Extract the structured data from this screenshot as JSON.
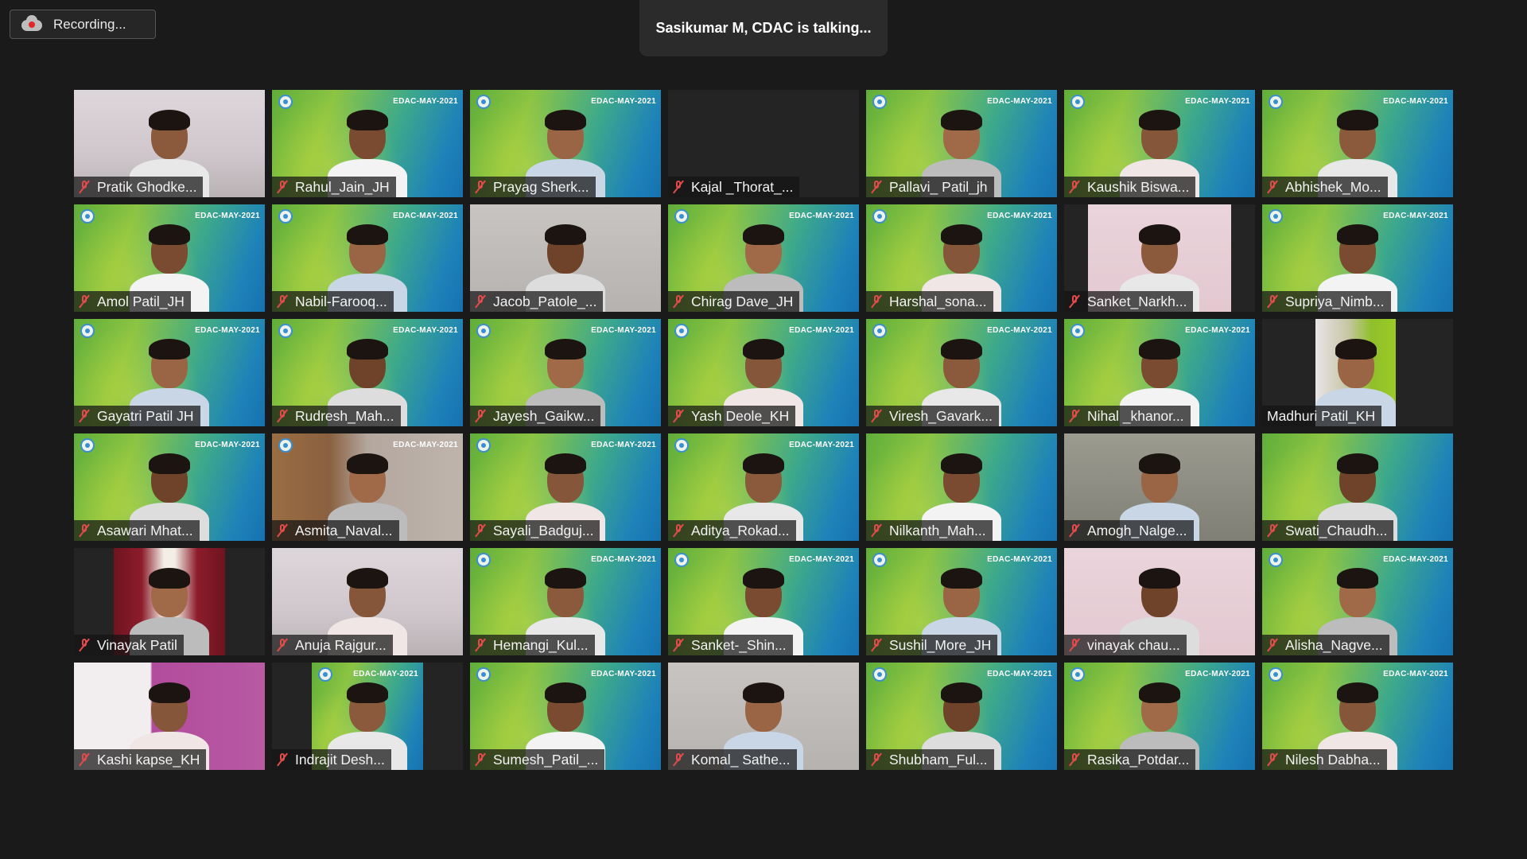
{
  "recording": {
    "label": "Recording..."
  },
  "speaker": {
    "text": "Sasikumar M, CDAC is talking..."
  },
  "batch_text": "EDAC-MAY-2021",
  "colors": {
    "mic_muted": "#e34b4b",
    "background": "#1a1a1a"
  },
  "participants": [
    {
      "name": "Pratik Ghodke...",
      "muted": true
    },
    {
      "name": "Rahul_Jain_JH",
      "muted": true
    },
    {
      "name": "Prayag Sherk...",
      "muted": true
    },
    {
      "name": "Kajal _Thorat_...",
      "muted": true
    },
    {
      "name": "Pallavi_ Patil_jh",
      "muted": true
    },
    {
      "name": "Kaushik Biswa...",
      "muted": true
    },
    {
      "name": "Abhishek_Mo...",
      "muted": true
    },
    {
      "name": "Amol Patil_JH",
      "muted": true
    },
    {
      "name": "Nabil-Farooq...",
      "muted": true
    },
    {
      "name": "Jacob_Patole_...",
      "muted": true
    },
    {
      "name": "Chirag Dave_JH",
      "muted": true
    },
    {
      "name": "Harshal_sona...",
      "muted": true
    },
    {
      "name": "Sanket_Narkh...",
      "muted": true
    },
    {
      "name": "Supriya_Nimb...",
      "muted": true
    },
    {
      "name": "Gayatri Patil JH",
      "muted": true
    },
    {
      "name": "Rudresh_Mah...",
      "muted": true
    },
    {
      "name": "Jayesh_Gaikw...",
      "muted": true
    },
    {
      "name": "Yash Deole_KH",
      "muted": true
    },
    {
      "name": "Viresh_Gavark...",
      "muted": true
    },
    {
      "name": "Nihal _khanor...",
      "muted": true
    },
    {
      "name": "Madhuri Patil_KH",
      "muted": false
    },
    {
      "name": "Asawari Mhat...",
      "muted": true
    },
    {
      "name": "Asmita_Naval...",
      "muted": true
    },
    {
      "name": "Sayali_Badguj...",
      "muted": true
    },
    {
      "name": "Aditya_Rokad...",
      "muted": true
    },
    {
      "name": "Nilkanth_Mah...",
      "muted": true
    },
    {
      "name": "Amogh_Nalge...",
      "muted": true
    },
    {
      "name": "Swati_Chaudh...",
      "muted": true
    },
    {
      "name": "Vinayak Patil",
      "muted": true
    },
    {
      "name": "Anuja Rajgur...",
      "muted": true
    },
    {
      "name": "Hemangi_Kul...",
      "muted": true
    },
    {
      "name": "Sanket-_Shin...",
      "muted": true
    },
    {
      "name": "Sushil_More_JH",
      "muted": true
    },
    {
      "name": "vinayak chau...",
      "muted": true
    },
    {
      "name": "Alisha_Nagve...",
      "muted": true
    },
    {
      "name": "Kashi kapse_KH",
      "muted": true
    },
    {
      "name": "Indrajit Desh...",
      "muted": true
    },
    {
      "name": "Sumesh_Patil_...",
      "muted": true
    },
    {
      "name": "Komal_ Sathe...",
      "muted": true
    },
    {
      "name": "Shubham_Ful...",
      "muted": true
    },
    {
      "name": "Rasika_Potdar...",
      "muted": true
    },
    {
      "name": "Nilesh Dabha...",
      "muted": true
    }
  ]
}
